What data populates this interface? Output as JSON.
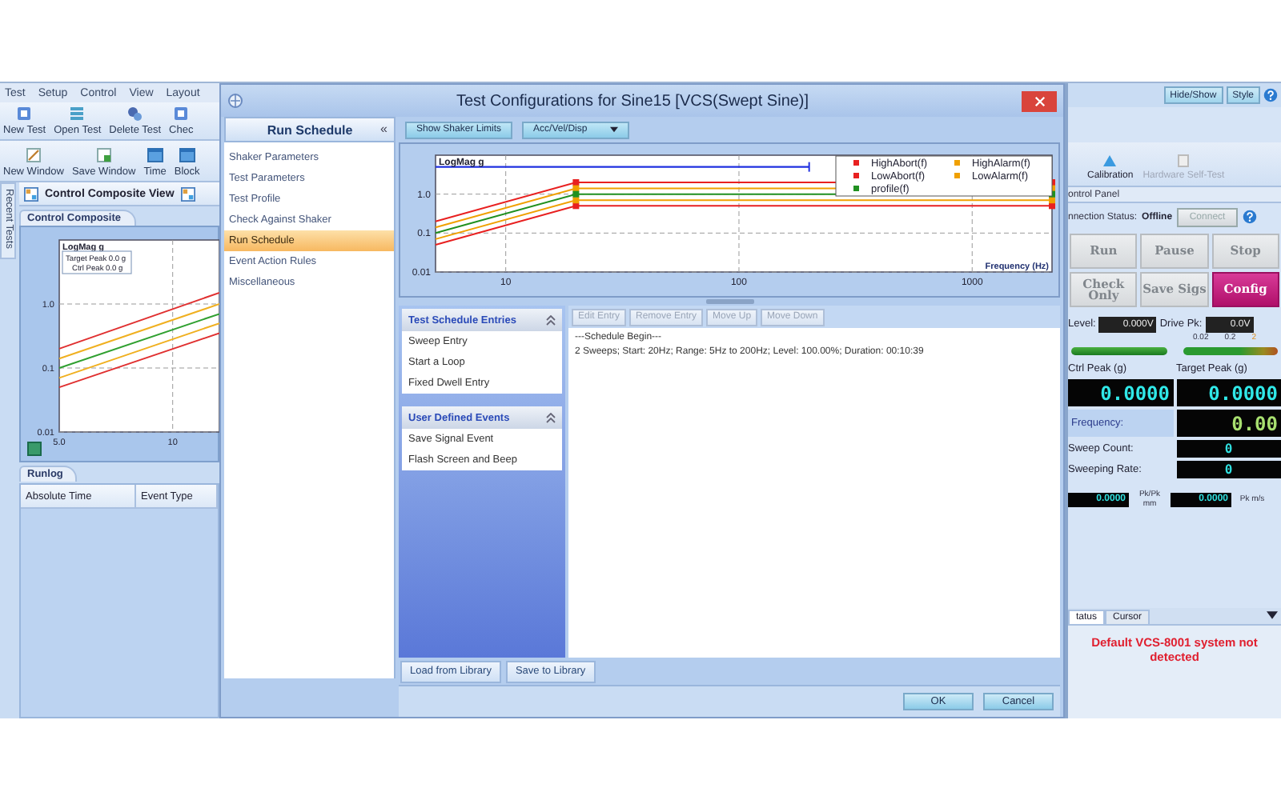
{
  "app": {
    "menu": [
      "Test",
      "Setup",
      "Control",
      "View",
      "Layout"
    ],
    "toolbar_1": [
      {
        "label": "New Test"
      },
      {
        "label": "Open Test"
      },
      {
        "label": "Delete Test"
      },
      {
        "label": "Chec"
      }
    ],
    "toolbar_2": [
      {
        "label": "New Window"
      },
      {
        "label": "Save Window"
      },
      {
        "label": "Time"
      },
      {
        "label": "Block"
      }
    ],
    "side_tab": "Recent Tests",
    "view_title": "Control Composite View",
    "view_tab": "Control Composite",
    "mini_chart": {
      "legend": [
        "Target Peak 0.0 g",
        "Ctrl Peak 0.0 g"
      ],
      "title": "LogMag g",
      "x_tick_labels": [
        "5.0",
        "10"
      ],
      "y_tick_labels": [
        "1.0",
        "0.1",
        "0.01"
      ]
    },
    "runlog": {
      "tab": "Runlog",
      "columns": [
        "Absolute Time",
        "Event Type"
      ]
    }
  },
  "dialog": {
    "title": "Test Configurations for Sine15 [VCS(Swept Sine)]",
    "nav": {
      "header": "Run Schedule",
      "collapse": "«",
      "items": [
        {
          "label": "Shaker Parameters",
          "selected": false
        },
        {
          "label": "Test Parameters",
          "selected": false
        },
        {
          "label": "Test Profile",
          "selected": false
        },
        {
          "label": "Check Against Shaker",
          "selected": false
        },
        {
          "label": "Run Schedule",
          "selected": true
        },
        {
          "label": "Event Action Rules",
          "selected": false
        },
        {
          "label": "Miscellaneous",
          "selected": false
        }
      ]
    },
    "chart_toolbar": {
      "button": "Show Shaker Limits",
      "dropdown": "Acc/Vel/Disp"
    },
    "chart": {
      "title": "LogMag g",
      "x_label": "Frequency (Hz)",
      "x_tick_labels": [
        "10",
        "100",
        "1000"
      ],
      "y_tick_labels": [
        "1.0",
        "0.1",
        "0.01"
      ],
      "legend": [
        {
          "name": "HighAbort(f)",
          "color": "#e82020"
        },
        {
          "name": "HighAlarm(f)",
          "color": "#f0a000"
        },
        {
          "name": "LowAbort(f)",
          "color": "#e82020"
        },
        {
          "name": "LowAlarm(f)",
          "color": "#f0a000"
        },
        {
          "name": "profile(f)",
          "color": "#209020"
        }
      ]
    },
    "entry_groups": [
      {
        "title": "Test Schedule Entries",
        "expanded": true,
        "items": [
          "Sweep Entry",
          "Start a Loop",
          "Fixed Dwell Entry"
        ]
      },
      {
        "title": "User Defined Events",
        "expanded": true,
        "items": [
          "Save Signal Event",
          "Flash Screen and Beep"
        ]
      }
    ],
    "schedule_toolbar": [
      {
        "label": "Edit Entry",
        "disabled": true
      },
      {
        "label": "Remove Entry",
        "disabled": true
      },
      {
        "label": "Move Up",
        "disabled": true
      },
      {
        "label": "Move Down",
        "disabled": true
      }
    ],
    "schedule_lines": [
      "---Schedule Begin---",
      "2 Sweeps; Start: 20Hz; Range: 5Hz to 200Hz; Level: 100.00%; Duration: 00:10:39"
    ],
    "library_buttons": [
      "Load from Library",
      "Save to Library"
    ],
    "buttons": [
      "OK",
      "Cancel"
    ]
  },
  "control_panel": {
    "top_buttons": [
      "Hide/Show",
      "Style"
    ],
    "tools": [
      {
        "label": "Calibration",
        "disabled": false
      },
      {
        "label": "Hardware Self-Test",
        "disabled": true
      }
    ],
    "header": "ontrol Panel",
    "connection": {
      "label": "nnection Status:",
      "value": "Offline",
      "button": {
        "label": "Connect",
        "disabled": true
      }
    },
    "actions": [
      {
        "label": "Run",
        "disabled": true
      },
      {
        "label": "Pause",
        "disabled": true
      },
      {
        "label": "Stop",
        "disabled": true
      },
      {
        "label": "Check Only",
        "disabled": true
      },
      {
        "label": "Save Sigs",
        "disabled": true
      },
      {
        "label": "Config",
        "disabled": false
      }
    ],
    "level": {
      "label": "Level:",
      "value": "0.000V"
    },
    "drive": {
      "label": "Drive Pk:",
      "value": "0.0V",
      "scale": [
        "0.02",
        "0.2",
        "2"
      ]
    },
    "peaks": [
      {
        "label": "Ctrl Peak (g)",
        "value": "0.0000"
      },
      {
        "label": "Target Peak (g)",
        "value": "0.0000"
      }
    ],
    "readouts": [
      {
        "label": "Frequency:",
        "value": "0.00",
        "color": "#a8e070"
      },
      {
        "label": "Sweep Count:",
        "value": "0",
        "color": "#30e0e0"
      },
      {
        "label": "Sweeping Rate:",
        "value": "0",
        "color": "#30e0e0"
      }
    ],
    "small_readouts": [
      {
        "value": "0.0000",
        "unit": "Pk/Pk mm"
      },
      {
        "value": "0.0000",
        "unit": "Pk m/s"
      }
    ],
    "status_tabs": [
      {
        "label": "tatus",
        "selected": true
      },
      {
        "label": "Cursor",
        "selected": false
      }
    ],
    "message": "Default VCS-8001 system not detected"
  }
}
